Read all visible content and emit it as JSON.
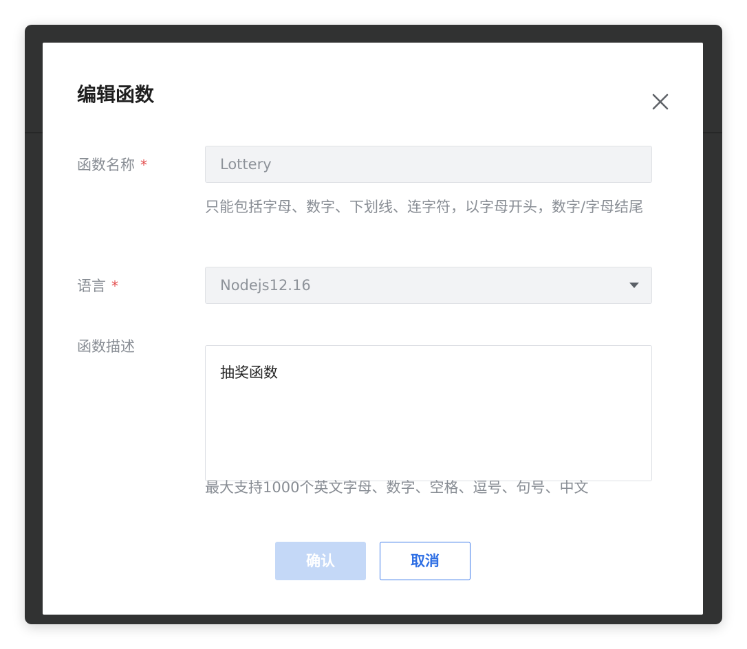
{
  "dialog": {
    "title": "编辑函数",
    "close_icon": "close-icon"
  },
  "fields": {
    "name": {
      "label": "函数名称",
      "required_mark": "*",
      "value": "Lottery",
      "hint": "只能包括字母、数字、下划线、连字符，以字母开头，数字/字母结尾"
    },
    "language": {
      "label": "语言",
      "required_mark": "*",
      "value": "Nodejs12.16",
      "arrow_icon": "caret-down-icon"
    },
    "description": {
      "label": "函数描述",
      "value": "抽奖函数",
      "hint": "最大支持1000个英文字母、数字、空格、逗号、句号、中文"
    }
  },
  "buttons": {
    "confirm": "确认",
    "cancel": "取消"
  },
  "colors": {
    "primary": "#3a78ea",
    "primary_disabled": "#c4d8f7",
    "required": "#e24b4b",
    "overlay": "#313232"
  }
}
